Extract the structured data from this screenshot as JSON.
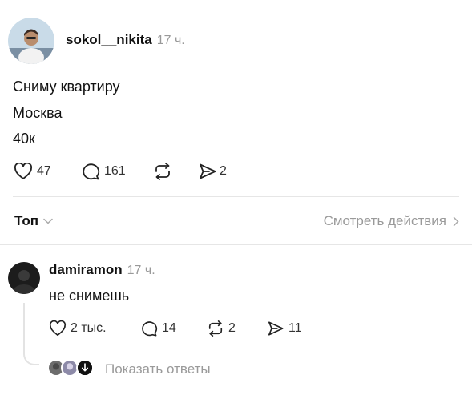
{
  "post": {
    "username": "sokol__nikita",
    "time": "17 ч.",
    "lines": [
      "Сниму квартиру",
      "Москва",
      "40к"
    ],
    "likes": "47",
    "comments": "161"
  },
  "replies_bar": {
    "sort_label": "Топ",
    "view_activity_label": "Смотреть действия"
  },
  "comment": {
    "username": "damiramon",
    "time": "17 ч.",
    "text": "не снимешь",
    "likes": "2 тыс.",
    "comments": "14",
    "reposts": "2",
    "shares": "11",
    "show_replies_label": "Показать ответы"
  },
  "icons": {
    "like": "heart-icon",
    "comment": "comment-bubble-icon",
    "repost": "repost-icon",
    "share": "send-icon",
    "chevron_down": "chevron-down-icon",
    "chevron_right": "chevron-right-icon"
  }
}
